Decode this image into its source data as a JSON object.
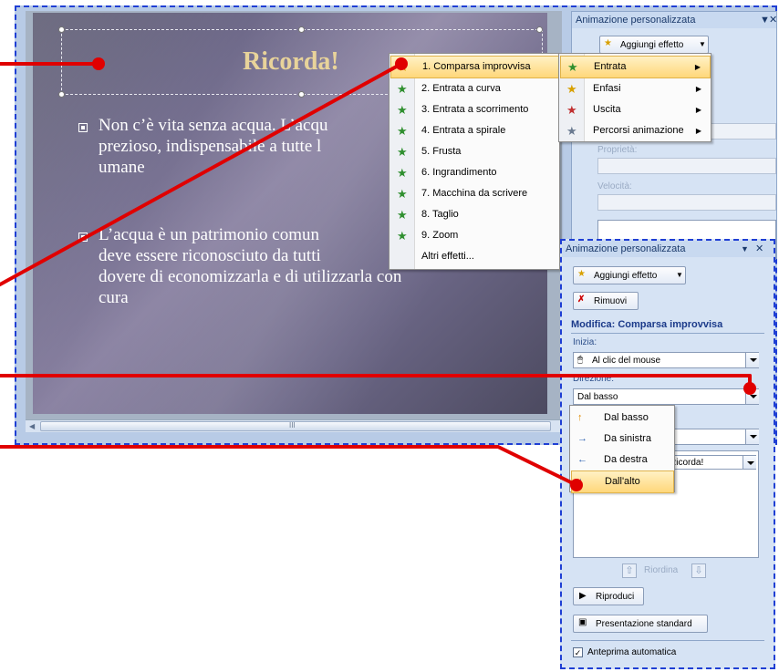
{
  "slide": {
    "title": "Ricorda!",
    "bullet1": "Non c’è vita senza acqua. L’acqu",
    "bullet1_line2": "prezioso, indispensabile a tutte l",
    "bullet1_line3": "umane",
    "bullet2": "L’acqua è un patrimonio comun",
    "bullet2_line2": "deve essere riconosciuto da tutti",
    "bullet2_line3": "dovere di economizzarla e di  utilizzarla con",
    "bullet2_line4": "cura",
    "scroll_mark": "III"
  },
  "effects_menu": {
    "items": [
      {
        "label": "1. Comparsa improvvisa",
        "highlighted": true
      },
      {
        "label": "2. Entrata a curva"
      },
      {
        "label": "3. Entrata a scorrimento"
      },
      {
        "label": "4. Entrata a spirale"
      },
      {
        "label": "5. Frusta"
      },
      {
        "label": "6. Ingrandimento"
      },
      {
        "label": "7. Macchina da scrivere"
      },
      {
        "label": "8. Taglio"
      },
      {
        "label": "9. Zoom"
      },
      {
        "label": "Altri effetti..."
      }
    ]
  },
  "category_menu": {
    "items": [
      {
        "label": "Entrata",
        "highlighted": true
      },
      {
        "label": "Enfasi"
      },
      {
        "label": "Uscita"
      },
      {
        "label": "Percorsi animazione"
      }
    ]
  },
  "back_pane": {
    "title": "Animazione personalizzata",
    "add_effect": "Aggiungi effetto",
    "proprieta": "Proprietà:",
    "velocita": "Velocità:"
  },
  "front_pane": {
    "title": "Animazione personalizzata",
    "add_effect": "Aggiungi effetto",
    "remove": "Rimuovi",
    "modifica": "Modifica: Comparsa improvvisa",
    "inizia_label": "Inizia:",
    "inizia_value": "Al clic del mouse",
    "direzione_label": "Direzione:",
    "direzione_value": "Dal basso",
    "list_item": "Ricorda!",
    "riordina": "Riordina",
    "riproduci": "Riproduci",
    "presentazione": "Presentazione standard",
    "anteprima": "Anteprima automatica",
    "anteprima_checked": true
  },
  "direction_menu": {
    "items": [
      {
        "label": "Dal basso",
        "icon": "arrow-up-icon"
      },
      {
        "label": "Da sinistra",
        "icon": "arrow-right-icon"
      },
      {
        "label": "Da destra",
        "icon": "arrow-left-icon"
      },
      {
        "label": "Dall'alto",
        "icon": "arrow-down-icon",
        "highlighted": true
      }
    ]
  },
  "colors": {
    "annotation_red": "#e00000",
    "frame_blue": "#1f3fd4",
    "title_gold": "#e8d39a"
  }
}
